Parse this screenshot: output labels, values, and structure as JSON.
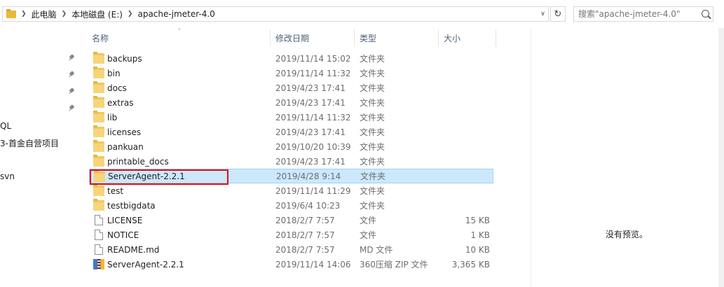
{
  "breadcrumb": [
    "此电脑",
    "本地磁盘 (E:)",
    "apache-jmeter-4.0"
  ],
  "search": {
    "placeholder": "搜索\"apache-jmeter-4.0\""
  },
  "nav": {
    "items": [
      "QL",
      "3-首金自营项目",
      "svn"
    ]
  },
  "columns": {
    "name": "名称",
    "date": "修改日期",
    "type": "类型",
    "size": "大小"
  },
  "files": [
    {
      "name": "backups",
      "date": "2019/11/14 15:02",
      "type": "文件夹",
      "size": "",
      "icon": "folder-icon"
    },
    {
      "name": "bin",
      "date": "2019/11/14 11:32",
      "type": "文件夹",
      "size": "",
      "icon": "folder-icon"
    },
    {
      "name": "docs",
      "date": "2019/4/23 17:41",
      "type": "文件夹",
      "size": "",
      "icon": "folder-icon"
    },
    {
      "name": "extras",
      "date": "2019/4/23 17:41",
      "type": "文件夹",
      "size": "",
      "icon": "folder-icon"
    },
    {
      "name": "lib",
      "date": "2019/11/14 11:32",
      "type": "文件夹",
      "size": "",
      "icon": "folder-icon"
    },
    {
      "name": "licenses",
      "date": "2019/4/23 17:41",
      "type": "文件夹",
      "size": "",
      "icon": "folder-icon"
    },
    {
      "name": "pankuan",
      "date": "2019/10/20 10:39",
      "type": "文件夹",
      "size": "",
      "icon": "folder-icon"
    },
    {
      "name": "printable_docs",
      "date": "2019/4/23 17:41",
      "type": "文件夹",
      "size": "",
      "icon": "folder-icon"
    },
    {
      "name": "ServerAgent-2.2.1",
      "date": "2019/4/28 9:14",
      "type": "文件夹",
      "size": "",
      "icon": "folder-icon",
      "selected": true
    },
    {
      "name": "test",
      "date": "2019/11/14 11:29",
      "type": "文件夹",
      "size": "",
      "icon": "folder-icon"
    },
    {
      "name": "testbigdata",
      "date": "2019/6/4 10:23",
      "type": "文件夹",
      "size": "",
      "icon": "folder-icon"
    },
    {
      "name": "LICENSE",
      "date": "2018/2/7 7:57",
      "type": "文件",
      "size": "15 KB",
      "icon": "file-icon"
    },
    {
      "name": "NOTICE",
      "date": "2018/2/7 7:57",
      "type": "文件",
      "size": "1 KB",
      "icon": "file-icon"
    },
    {
      "name": "README.md",
      "date": "2018/2/7 7:57",
      "type": "MD 文件",
      "size": "10 KB",
      "icon": "file-icon"
    },
    {
      "name": "ServerAgent-2.2.1",
      "date": "2019/11/14 14:06",
      "type": "360压缩 ZIP 文件",
      "size": "3,365 KB",
      "icon": "zip-archive-icon"
    }
  ],
  "preview": {
    "text": "没有预览。"
  },
  "colors": {
    "selection": "#cce8ff",
    "selection_border": "#99d1ff",
    "highlight": "#e10d14",
    "folder": "#f0c85b",
    "header_text": "#4c607a"
  }
}
